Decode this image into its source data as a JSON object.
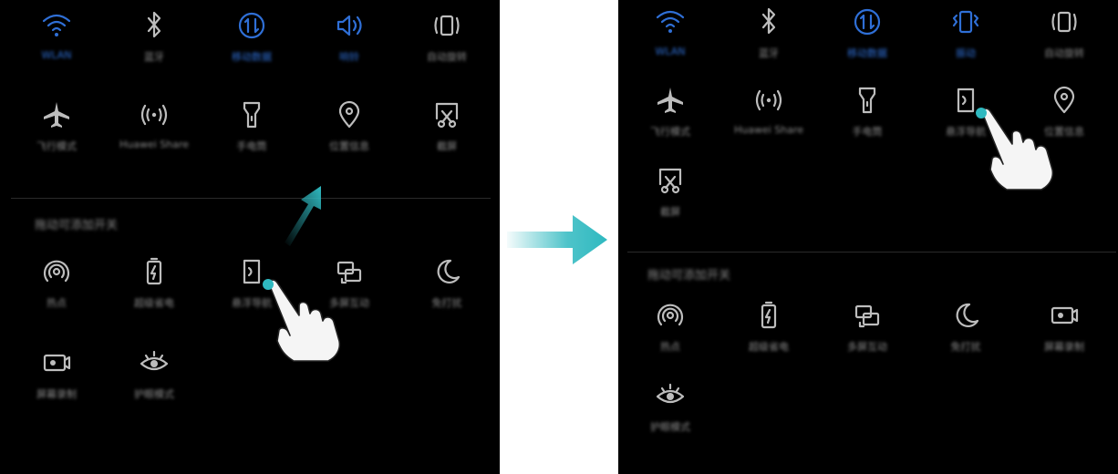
{
  "colors": {
    "blue": "#2f6fd6",
    "gray": "#bdbdbd",
    "teal": "#2fb9c0",
    "bg": "#000000"
  },
  "left": {
    "row1": [
      {
        "icon": "wifi-icon",
        "label": "WLAN",
        "active": true
      },
      {
        "icon": "bluetooth-icon",
        "label": "蓝牙",
        "active": false
      },
      {
        "icon": "mobile-data-icon",
        "label": "移动数据",
        "active": true
      },
      {
        "icon": "sound-icon",
        "label": "响铃",
        "active": true
      },
      {
        "icon": "auto-rotate-icon",
        "label": "自动旋转",
        "active": false
      }
    ],
    "row2": [
      {
        "icon": "airplane-icon",
        "label": "飞行模式"
      },
      {
        "icon": "huawei-share-icon",
        "label": "Huawei Share"
      },
      {
        "icon": "flashlight-icon",
        "label": "手电筒"
      },
      {
        "icon": "location-icon",
        "label": "位置信息"
      },
      {
        "icon": "screenshot-icon",
        "label": "截屏"
      }
    ],
    "section_title": "拖动可添加开关",
    "row3": [
      {
        "icon": "hotspot-icon",
        "label": "热点"
      },
      {
        "icon": "battery-saver-icon",
        "label": "超级省电"
      },
      {
        "icon": "floating-dock-icon",
        "label": "悬浮导航"
      },
      {
        "icon": "multi-screen-icon",
        "label": "多屏互动"
      },
      {
        "icon": "do-not-disturb-icon",
        "label": "免打扰"
      }
    ],
    "row4": [
      {
        "icon": "screen-record-icon",
        "label": "屏幕录制"
      },
      {
        "icon": "eye-comfort-icon",
        "label": "护眼模式"
      }
    ]
  },
  "right": {
    "row1": [
      {
        "icon": "wifi-icon",
        "label": "WLAN",
        "active": true
      },
      {
        "icon": "bluetooth-icon",
        "label": "蓝牙",
        "active": false
      },
      {
        "icon": "mobile-data-icon",
        "label": "移动数据",
        "active": true
      },
      {
        "icon": "vibrate-icon",
        "label": "振动",
        "active": true
      },
      {
        "icon": "auto-rotate-icon",
        "label": "自动旋转",
        "active": false
      }
    ],
    "row2": [
      {
        "icon": "airplane-icon",
        "label": "飞行模式"
      },
      {
        "icon": "huawei-share-icon",
        "label": "Huawei Share"
      },
      {
        "icon": "flashlight-icon",
        "label": "手电筒"
      },
      {
        "icon": "floating-dock-icon",
        "label": "悬浮导航"
      },
      {
        "icon": "location-icon",
        "label": "位置信息"
      }
    ],
    "row3": [
      {
        "icon": "screenshot-icon",
        "label": "截屏"
      }
    ],
    "section_title": "拖动可添加开关",
    "row4": [
      {
        "icon": "hotspot-icon",
        "label": "热点"
      },
      {
        "icon": "battery-saver-icon",
        "label": "超级省电"
      },
      {
        "icon": "multi-screen-icon",
        "label": "多屏互动"
      },
      {
        "icon": "do-not-disturb-icon",
        "label": "免打扰"
      },
      {
        "icon": "screen-record-icon",
        "label": "屏幕录制"
      }
    ],
    "row5": [
      {
        "icon": "eye-comfort-icon",
        "label": "护眼模式"
      }
    ]
  }
}
